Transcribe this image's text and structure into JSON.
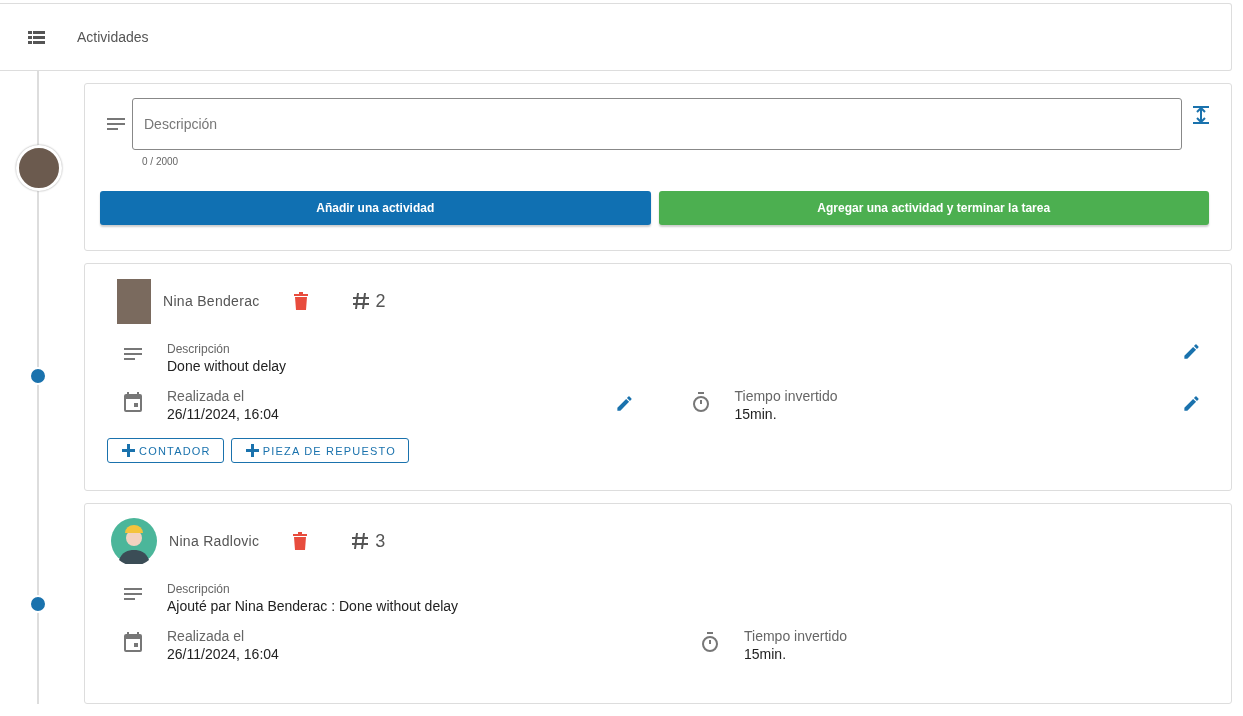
{
  "header": {
    "title": "Actividades"
  },
  "composer": {
    "placeholder": "Descripción",
    "counter": "0 / 2000",
    "buttons": [
      {
        "label": "Añadir una actividad",
        "kind": "primary"
      },
      {
        "label": "Agregar una actividad y terminar la tarea",
        "kind": "success"
      }
    ]
  },
  "activities": [
    {
      "author": "Nina Benderac",
      "kind": "photo",
      "number": "2",
      "editable": true,
      "description_label": "Descripción",
      "description": "Done without delay",
      "date_label": "Realizada el",
      "date": "26/11/2024, 16:04",
      "time_label": "Tiempo invertido",
      "time": "15min.",
      "actions": [
        "CONTADOR",
        "PIEZA DE REPUESTO"
      ]
    },
    {
      "author": "Nina Radlovic",
      "kind": "worker",
      "number": "3",
      "editable": false,
      "description_label": "Descripción",
      "description": "Ajouté par Nina Benderac : Done without delay",
      "date_label": "Realizada el",
      "date": "26/11/2024, 16:04",
      "time_label": "Tiempo invertido",
      "time": "15min."
    }
  ]
}
